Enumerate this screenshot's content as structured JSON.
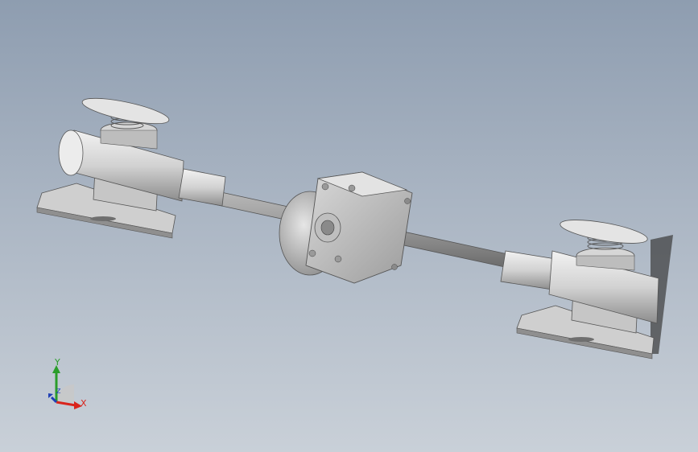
{
  "viewport": {
    "background_top": "#8e9db0",
    "background_bottom": "#c9d0d8",
    "part_color": "#d4d4d4",
    "part_shadow": "#8a8a8a"
  },
  "triad": {
    "x_label": "X",
    "y_label": "Y",
    "z_label": "Z",
    "x_color": "#d9241c",
    "y_color": "#2a9d2a",
    "z_color": "#1f3fb5"
  }
}
